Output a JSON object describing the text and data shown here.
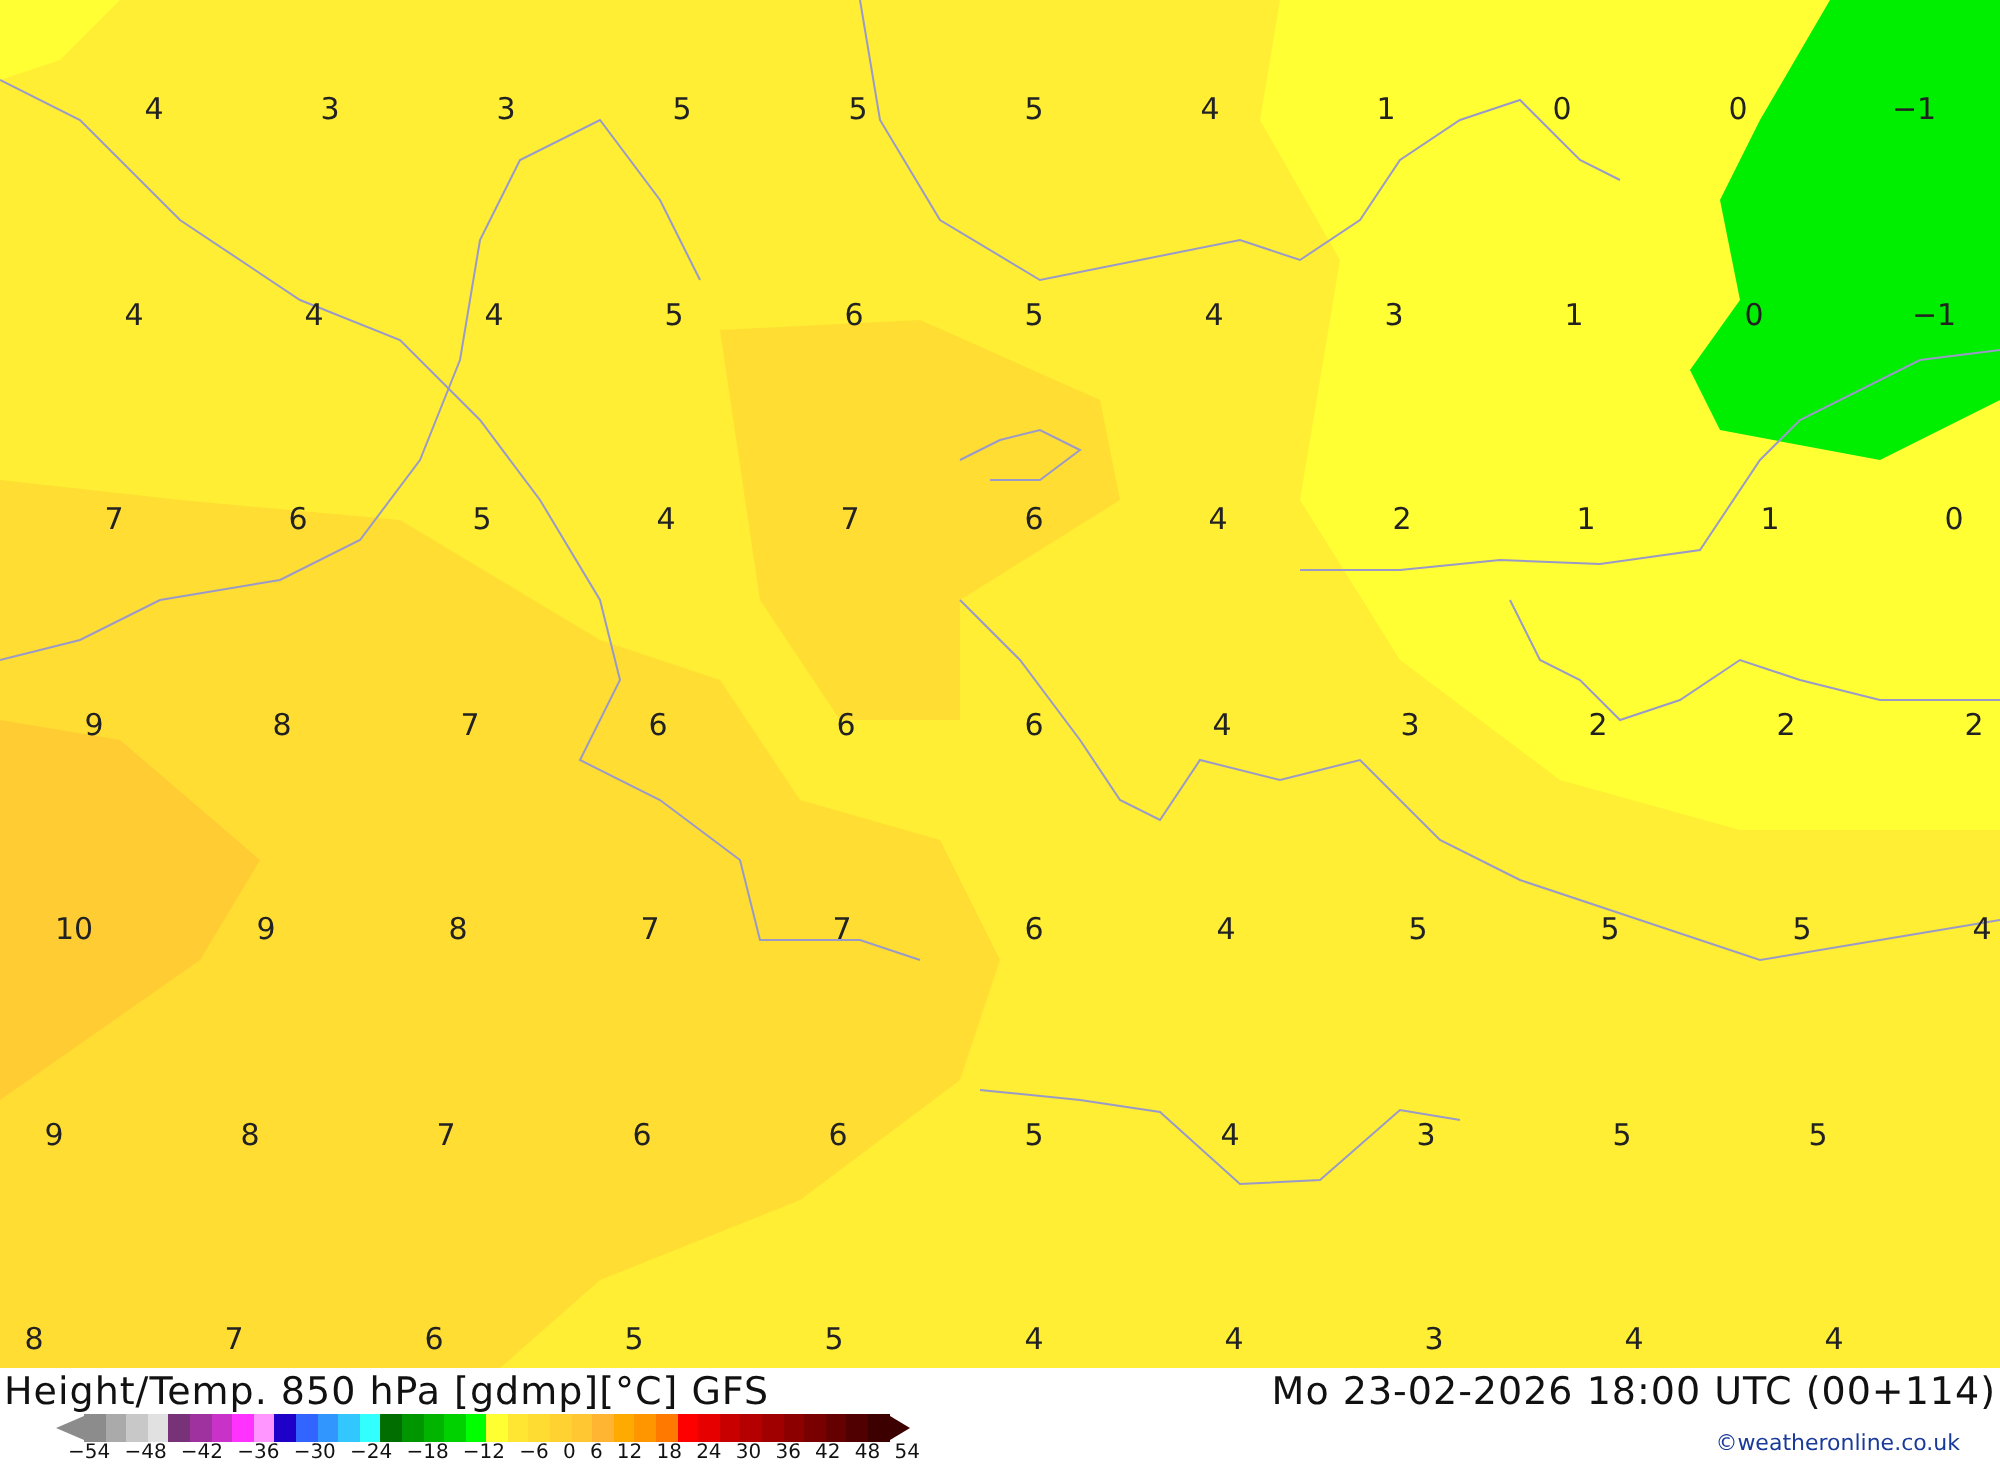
{
  "map": {
    "label_rows": [
      [
        "4",
        "3",
        "3",
        "5",
        "5",
        "5",
        "4",
        "1",
        "0",
        "0",
        "−1"
      ],
      [
        "4",
        "4",
        "4",
        "5",
        "6",
        "5",
        "4",
        "3",
        "1",
        "0",
        "−1"
      ],
      [
        "7",
        "6",
        "5",
        "4",
        "7",
        "6",
        "4",
        "2",
        "1",
        "1",
        "0"
      ],
      [
        "9",
        "8",
        "7",
        "6",
        "6",
        "6",
        "4",
        "3",
        "2",
        "2",
        "2"
      ],
      [
        "10",
        "9",
        "8",
        "7",
        "7",
        "6",
        "4",
        "5",
        "5",
        "5",
        "4"
      ],
      [
        "9",
        "8",
        "7",
        "6",
        "6",
        "5",
        "4",
        "3",
        "5",
        "5"
      ],
      [
        "8",
        "7",
        "6",
        "5",
        "5",
        "4",
        "4",
        "3",
        "4",
        "4"
      ]
    ]
  },
  "footer": {
    "title": "Height/Temp. 850 hPa [gdmp][°C] GFS",
    "valid_time": "Mo 23-02-2026 18:00 UTC (00+114)",
    "credit": "©weatheronline.co.uk"
  },
  "legend": {
    "swatches": [
      {
        "color": "#8c8c8c"
      },
      {
        "color": "#aaaaaa"
      },
      {
        "color": "#c8c8c8"
      },
      {
        "color": "#e1e1e1"
      },
      {
        "color": "#783278"
      },
      {
        "color": "#a032a0"
      },
      {
        "color": "#c832c8"
      },
      {
        "color": "#ff32ff"
      },
      {
        "color": "#ff96ff"
      },
      {
        "color": "#1e00c8"
      },
      {
        "color": "#3264ff"
      },
      {
        "color": "#3296ff"
      },
      {
        "color": "#32c8ff"
      },
      {
        "color": "#32ffff"
      },
      {
        "color": "#006e00"
      },
      {
        "color": "#009600"
      },
      {
        "color": "#00b400"
      },
      {
        "color": "#00d200"
      },
      {
        "color": "#00ff00"
      },
      {
        "color": "#ffff32"
      },
      {
        "color": "#ffe632"
      },
      {
        "color": "#ffdc32"
      },
      {
        "color": "#ffd232"
      },
      {
        "color": "#ffc832"
      },
      {
        "color": "#ffb432"
      },
      {
        "color": "#ffaa00"
      },
      {
        "color": "#ff9600"
      },
      {
        "color": "#ff7800"
      },
      {
        "color": "#ff0000"
      },
      {
        "color": "#e60000"
      },
      {
        "color": "#c80000"
      },
      {
        "color": "#b40000"
      },
      {
        "color": "#a00000"
      },
      {
        "color": "#8c0000"
      },
      {
        "color": "#780000"
      },
      {
        "color": "#640000"
      },
      {
        "color": "#500000"
      },
      {
        "color": "#3c0000"
      }
    ],
    "ticks": [
      "−54",
      "−48",
      "−42",
      "−36",
      "−30",
      "−24",
      "−18",
      "−12",
      "−6",
      "0",
      "6",
      "12",
      "18",
      "24",
      "30",
      "36",
      "42",
      "48",
      "54"
    ]
  }
}
